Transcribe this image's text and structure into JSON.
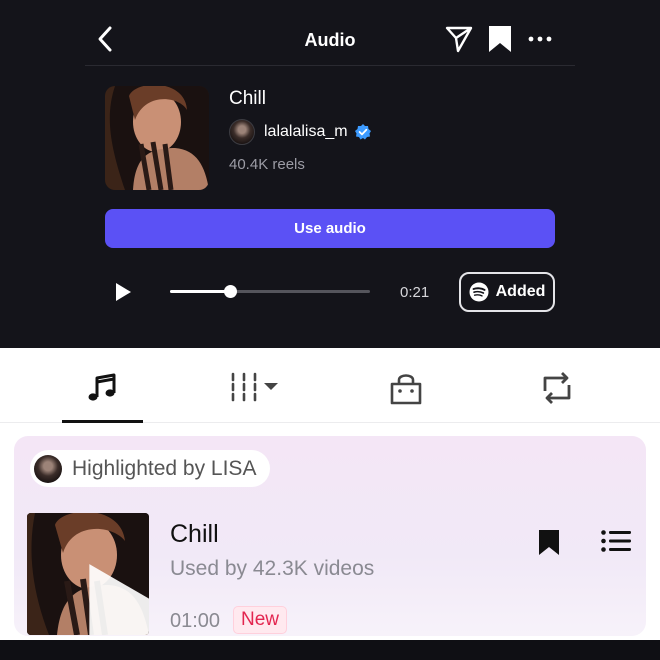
{
  "navbar": {
    "title": "Audio",
    "icons": {
      "back": "chevron-left-icon",
      "send": "paper-plane-icon",
      "save": "bookmark-icon",
      "more": "more-horizontal-icon"
    }
  },
  "audio": {
    "title": "Chill",
    "artist": "lalalalisa_m",
    "verified": true,
    "reels": "40.4K reels",
    "use_button": "Use audio",
    "time": "0:21",
    "progress": 0.3,
    "added_label": "Added"
  },
  "tabs": [
    {
      "icon": "music-note-icon",
      "selected": true
    },
    {
      "icon": "bars-dropdown-icon",
      "selected": false
    },
    {
      "icon": "shopping-bag-icon",
      "selected": false
    },
    {
      "icon": "repost-icon",
      "selected": false
    }
  ],
  "highlight": {
    "label": "Highlighted by LISA",
    "track": {
      "title": "Chill",
      "used_by": "Used by 42.3K videos",
      "duration": "01:00",
      "badge": "New"
    }
  },
  "colors": {
    "dark_bg": "#14141a",
    "accent": "#5b51f5",
    "verified": "#3d9bff",
    "badge_text": "#e3254f",
    "card_bg": "#f3e8f6"
  }
}
